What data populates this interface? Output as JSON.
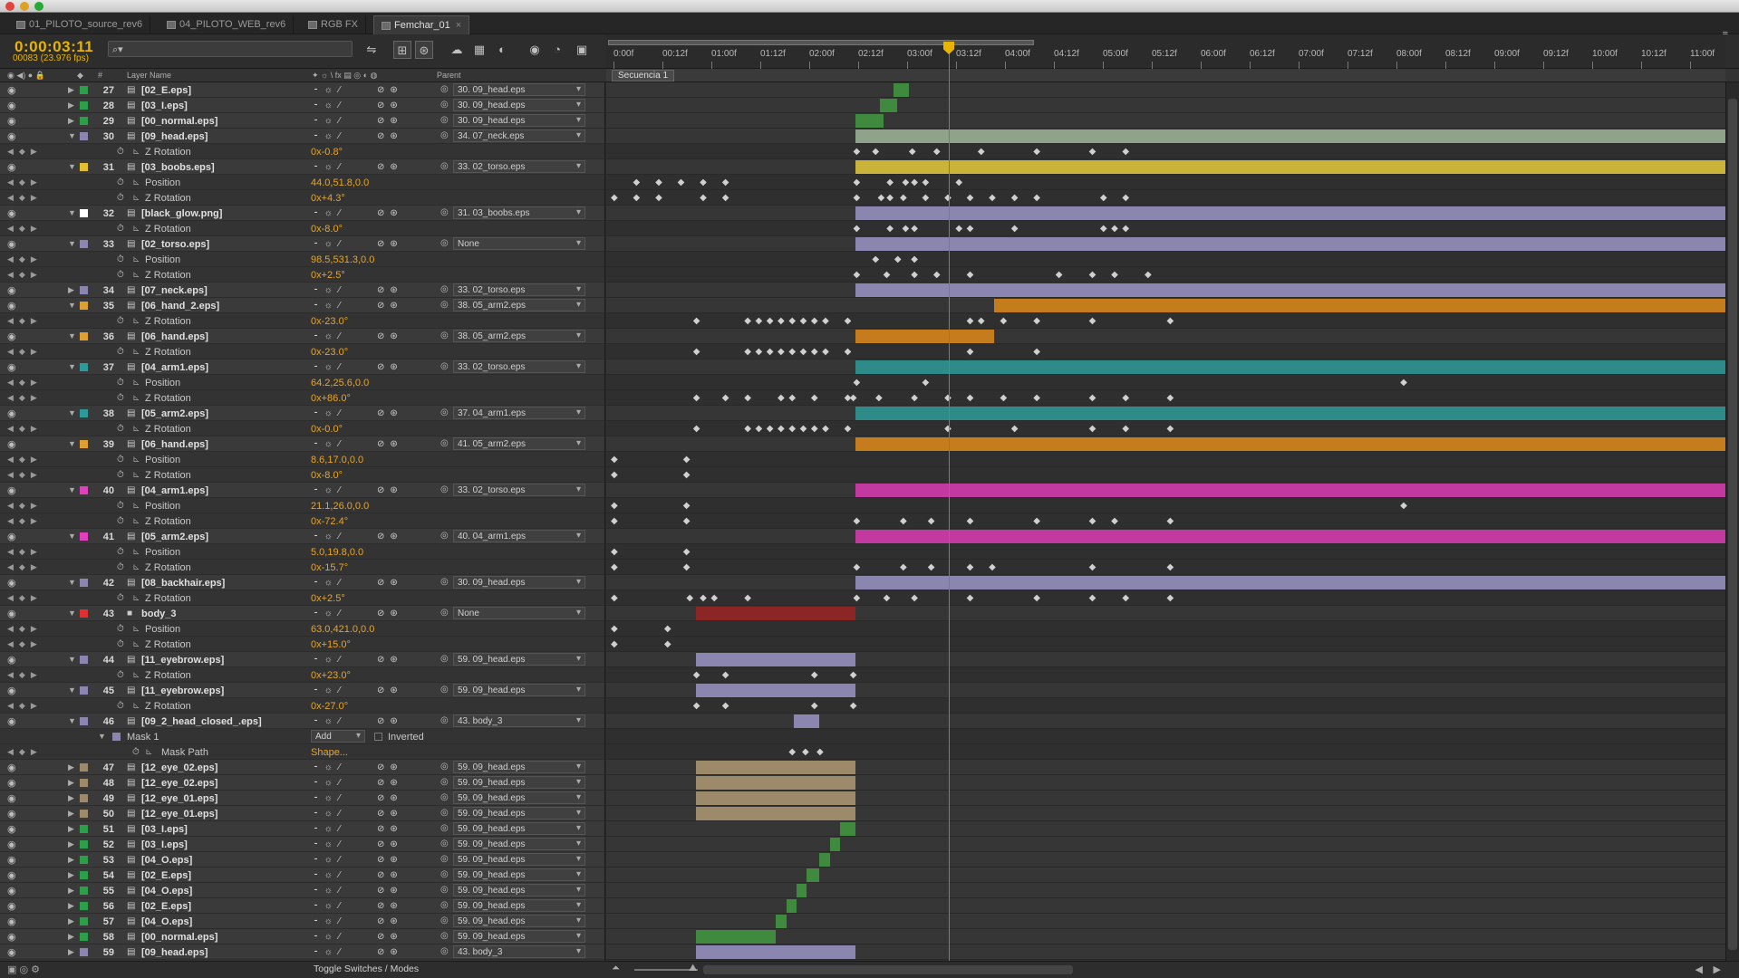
{
  "window": {
    "tabs": [
      {
        "label": "01_PILOTO_source_rev6"
      },
      {
        "label": "04_PILOTO_WEB_rev6"
      },
      {
        "label": "RGB FX"
      },
      {
        "label": "Femchar_01",
        "active": true
      }
    ]
  },
  "header": {
    "timecode": "0:00:03:11",
    "frames": "00083 (23.976 fps)",
    "search_placeholder": "⌕▾"
  },
  "columns": {
    "num": "#",
    "layer_name": "Layer Name",
    "parent": "Parent"
  },
  "composition": "Secuencia 1",
  "ruler": [
    "0:00f",
    "00:12f",
    "01:00f",
    "01:12f",
    "02:00f",
    "02:12f",
    "03:00f",
    "03:12f",
    "04:00f",
    "04:12f",
    "05:00f",
    "05:12f",
    "06:00f",
    "06:12f",
    "07:00f",
    "07:12f",
    "08:00f",
    "08:12f",
    "09:00f",
    "09:12f",
    "10:00f",
    "10:12f",
    "11:00f"
  ],
  "footer": {
    "toggle": "Toggle Switches / Modes"
  },
  "colors": {
    "green": "#3f8a3f",
    "lavender": "#8a86b0",
    "olive": "#c9b338",
    "orange": "#c47c1c",
    "teal": "#2f8a8a",
    "magenta": "#c23aa0",
    "red": "#8a2626",
    "tan": "#9c8a6a",
    "sage": "#8fa38a"
  },
  "rows": [
    {
      "k": "L",
      "n": "27",
      "name": "[02_E.eps]",
      "label": "#2e9e4a",
      "parent": "30. 09_head.eps",
      "bar": {
        "s": 0.252,
        "e": 0.266,
        "c": "green"
      }
    },
    {
      "k": "L",
      "n": "28",
      "name": "[03_I.eps]",
      "label": "#2e9e4a",
      "parent": "30. 09_head.eps",
      "bar": {
        "s": 0.24,
        "e": 0.255,
        "c": "green"
      }
    },
    {
      "k": "L",
      "n": "29",
      "name": "[00_normal.eps]",
      "label": "#2e9e4a",
      "parent": "30. 09_head.eps",
      "bar": {
        "s": 0.218,
        "e": 0.243,
        "c": "green"
      }
    },
    {
      "k": "L",
      "n": "30",
      "name": "[09_head.eps]",
      "label": "#8a86b0",
      "parent": "34. 07_neck.eps",
      "open": true,
      "bar": {
        "s": 0.218,
        "e": 1,
        "c": "sage"
      }
    },
    {
      "k": "P",
      "name": "Z Rotation",
      "val": "0x-0.8°",
      "keys": [
        0.218,
        0.235,
        0.268,
        0.29,
        0.33,
        0.38,
        0.43,
        0.46
      ]
    },
    {
      "k": "L",
      "n": "31",
      "name": "[03_boobs.eps]",
      "label": "#e0c030",
      "parent": "33. 02_torso.eps",
      "open": true,
      "bar": {
        "s": 0.218,
        "e": 1,
        "c": "olive"
      }
    },
    {
      "k": "P",
      "name": "Position",
      "val": "44.0,51.8,0.0",
      "keys": [
        0.02,
        0.04,
        0.06,
        0.08,
        0.1,
        0.218,
        0.248,
        0.262,
        0.27,
        0.28,
        0.31
      ]
    },
    {
      "k": "P",
      "name": "Z Rotation",
      "val": "0x+4.3°",
      "keys": [
        0.0,
        0.02,
        0.04,
        0.08,
        0.1,
        0.218,
        0.24,
        0.248,
        0.26,
        0.28,
        0.3,
        0.32,
        0.34,
        0.36,
        0.38,
        0.44,
        0.46
      ]
    },
    {
      "k": "L",
      "n": "32",
      "name": "[black_glow.png]",
      "label": "#ffffff",
      "parent": "31. 03_boobs.eps",
      "open": true,
      "bar": {
        "s": 0.218,
        "e": 1,
        "c": "lavender"
      }
    },
    {
      "k": "P",
      "name": "Z Rotation",
      "val": "0x-8.0°",
      "keys": [
        0.218,
        0.248,
        0.262,
        0.27,
        0.31,
        0.32,
        0.36,
        0.44,
        0.45,
        0.46
      ]
    },
    {
      "k": "L",
      "n": "33",
      "name": "[02_torso.eps]",
      "label": "#8a86b0",
      "parent": "None",
      "open": true,
      "bar": {
        "s": 0.218,
        "e": 1,
        "c": "lavender"
      }
    },
    {
      "k": "P",
      "name": "Position",
      "val": "98.5,531.3,0.0",
      "keys": [
        0.235,
        0.255,
        0.27
      ]
    },
    {
      "k": "P",
      "name": "Z Rotation",
      "val": "0x+2.5°",
      "keys": [
        0.218,
        0.245,
        0.27,
        0.29,
        0.32,
        0.4,
        0.43,
        0.45,
        0.48
      ]
    },
    {
      "k": "L",
      "n": "34",
      "name": "[07_neck.eps]",
      "label": "#8a86b0",
      "parent": "33. 02_torso.eps",
      "bar": {
        "s": 0.218,
        "e": 1,
        "c": "lavender"
      }
    },
    {
      "k": "L",
      "n": "35",
      "name": "[06_hand_2.eps]",
      "label": "#e0a030",
      "parent": "38. 05_arm2.eps",
      "open": true,
      "bar": {
        "s": 0.342,
        "e": 1,
        "c": "orange"
      }
    },
    {
      "k": "P",
      "name": "Z Rotation",
      "val": "0x-23.0°",
      "keys": [
        0.074,
        0.12,
        0.13,
        0.14,
        0.15,
        0.16,
        0.17,
        0.18,
        0.19,
        0.21,
        0.32,
        0.33,
        0.35,
        0.38,
        0.43,
        0.5
      ]
    },
    {
      "k": "L",
      "n": "36",
      "name": "[06_hand.eps]",
      "label": "#e0a030",
      "parent": "38. 05_arm2.eps",
      "open": true,
      "bar": {
        "s": 0.218,
        "e": 0.342,
        "c": "orange"
      }
    },
    {
      "k": "P",
      "name": "Z Rotation",
      "val": "0x-23.0°",
      "keys": [
        0.074,
        0.12,
        0.13,
        0.14,
        0.15,
        0.16,
        0.17,
        0.18,
        0.19,
        0.21,
        0.32,
        0.38
      ]
    },
    {
      "k": "L",
      "n": "37",
      "name": "[04_arm1.eps]",
      "label": "#2f9a9a",
      "parent": "33. 02_torso.eps",
      "open": true,
      "bar": {
        "s": 0.218,
        "e": 1,
        "c": "teal"
      }
    },
    {
      "k": "P",
      "name": "Position",
      "val": "64.2,25.6,0.0",
      "keys": [
        0.218,
        0.28,
        0.71
      ]
    },
    {
      "k": "P",
      "name": "Z Rotation",
      "val": "0x+86.0°",
      "keys": [
        0.074,
        0.1,
        0.12,
        0.15,
        0.16,
        0.18,
        0.21,
        0.215,
        0.238,
        0.27,
        0.3,
        0.32,
        0.35,
        0.38,
        0.43,
        0.46,
        0.5
      ]
    },
    {
      "k": "L",
      "n": "38",
      "name": "[05_arm2.eps]",
      "label": "#2f9a9a",
      "parent": "37. 04_arm1.eps",
      "open": true,
      "bar": {
        "s": 0.218,
        "e": 1,
        "c": "teal"
      }
    },
    {
      "k": "P",
      "name": "Z Rotation",
      "val": "0x-0.0°",
      "keys": [
        0.074,
        0.12,
        0.13,
        0.14,
        0.15,
        0.16,
        0.17,
        0.18,
        0.19,
        0.21,
        0.3,
        0.36,
        0.43,
        0.46,
        0.5
      ]
    },
    {
      "k": "L",
      "n": "39",
      "name": "[06_hand.eps]",
      "label": "#e0a030",
      "parent": "41. 05_arm2.eps",
      "open": true,
      "bar": {
        "s": 0.218,
        "e": 1,
        "c": "orange"
      }
    },
    {
      "k": "P",
      "name": "Position",
      "val": "8.6,17.0,0.0",
      "keys": [
        0.0,
        0.065
      ]
    },
    {
      "k": "P",
      "name": "Z Rotation",
      "val": "0x-8.0°",
      "keys": [
        0.0,
        0.065
      ]
    },
    {
      "k": "L",
      "n": "40",
      "name": "[04_arm1.eps]",
      "label": "#e040c0",
      "parent": "33. 02_torso.eps",
      "open": true,
      "bar": {
        "s": 0.218,
        "e": 1,
        "c": "magenta"
      }
    },
    {
      "k": "P",
      "name": "Position",
      "val": "21.1,26.0,0.0",
      "keys": [
        0.0,
        0.065,
        0.71
      ]
    },
    {
      "k": "P",
      "name": "Z Rotation",
      "val": "0x-72.4°",
      "keys": [
        0.0,
        0.065,
        0.218,
        0.26,
        0.285,
        0.32,
        0.38,
        0.43,
        0.45,
        0.5
      ]
    },
    {
      "k": "L",
      "n": "41",
      "name": "[05_arm2.eps]",
      "label": "#e040c0",
      "parent": "40. 04_arm1.eps",
      "open": true,
      "bar": {
        "s": 0.218,
        "e": 1,
        "c": "magenta"
      }
    },
    {
      "k": "P",
      "name": "Position",
      "val": "5.0,19.8,0.0",
      "keys": [
        0.0,
        0.065
      ]
    },
    {
      "k": "P",
      "name": "Z Rotation",
      "val": "0x-15.7°",
      "keys": [
        0.0,
        0.065,
        0.218,
        0.26,
        0.285,
        0.32,
        0.34,
        0.43,
        0.5
      ]
    },
    {
      "k": "L",
      "n": "42",
      "name": "[08_backhair.eps]",
      "label": "#8a86b0",
      "parent": "30. 09_head.eps",
      "open": true,
      "bar": {
        "s": 0.218,
        "e": 1,
        "c": "lavender"
      }
    },
    {
      "k": "P",
      "name": "Z Rotation",
      "val": "0x+2.5°",
      "keys": [
        0.0,
        0.068,
        0.08,
        0.09,
        0.12,
        0.218,
        0.245,
        0.27,
        0.32,
        0.38,
        0.43,
        0.46,
        0.5
      ]
    },
    {
      "k": "L",
      "n": "43",
      "name": "body_3",
      "label": "#e03030",
      "parent": "None",
      "open": true,
      "solid": true,
      "bar": {
        "s": 0.074,
        "e": 0.218,
        "c": "red"
      }
    },
    {
      "k": "P",
      "name": "Position",
      "val": "63.0,421.0,0.0",
      "keys": [
        0.0,
        0.048
      ]
    },
    {
      "k": "P",
      "name": "Z Rotation",
      "val": "0x+15.0°",
      "keys": [
        0.0,
        0.048
      ]
    },
    {
      "k": "L",
      "n": "44",
      "name": "[11_eyebrow.eps]",
      "label": "#8a86b0",
      "parent": "59. 09_head.eps",
      "open": true,
      "bar": {
        "s": 0.074,
        "e": 0.218,
        "c": "lavender"
      }
    },
    {
      "k": "P",
      "name": "Z Rotation",
      "val": "0x+23.0°",
      "keys": [
        0.074,
        0.1,
        0.18,
        0.215
      ]
    },
    {
      "k": "L",
      "n": "45",
      "name": "[11_eyebrow.eps]",
      "label": "#8a86b0",
      "parent": "59. 09_head.eps",
      "open": true,
      "bar": {
        "s": 0.074,
        "e": 0.218,
        "c": "lavender"
      }
    },
    {
      "k": "P",
      "name": "Z Rotation",
      "val": "0x-27.0°",
      "keys": [
        0.074,
        0.1,
        0.18,
        0.215
      ]
    },
    {
      "k": "L",
      "n": "46",
      "name": "[09_2_head_closed_.eps]",
      "label": "#8a86b0",
      "parent": "43. body_3",
      "open": true,
      "bar": {
        "s": 0.162,
        "e": 0.185,
        "c": "lavender"
      }
    },
    {
      "k": "M",
      "name": "Mask 1",
      "mode": "Add",
      "inverted": "Inverted"
    },
    {
      "k": "P",
      "name": "Mask Path",
      "val": "Shape...",
      "indent": true,
      "keys": [
        0.16,
        0.172,
        0.185
      ]
    },
    {
      "k": "L",
      "n": "47",
      "name": "[12_eye_02.eps]",
      "label": "#9c8a6a",
      "parent": "59. 09_head.eps",
      "bar": {
        "s": 0.074,
        "e": 0.218,
        "c": "tan"
      }
    },
    {
      "k": "L",
      "n": "48",
      "name": "[12_eye_02.eps]",
      "label": "#9c8a6a",
      "parent": "59. 09_head.eps",
      "bar": {
        "s": 0.074,
        "e": 0.218,
        "c": "tan"
      }
    },
    {
      "k": "L",
      "n": "49",
      "name": "[12_eye_01.eps]",
      "label": "#9c8a6a",
      "parent": "59. 09_head.eps",
      "bar": {
        "s": 0.074,
        "e": 0.218,
        "c": "tan"
      }
    },
    {
      "k": "L",
      "n": "50",
      "name": "[12_eye_01.eps]",
      "label": "#9c8a6a",
      "parent": "59. 09_head.eps",
      "bar": {
        "s": 0.074,
        "e": 0.218,
        "c": "tan"
      }
    },
    {
      "k": "L",
      "n": "51",
      "name": "[03_I.eps]",
      "label": "#2e9e4a",
      "parent": "59. 09_head.eps",
      "bar": {
        "s": 0.204,
        "e": 0.218,
        "c": "green"
      }
    },
    {
      "k": "L",
      "n": "52",
      "name": "[03_I.eps]",
      "label": "#2e9e4a",
      "parent": "59. 09_head.eps",
      "bar": {
        "s": 0.195,
        "e": 0.204,
        "c": "green"
      }
    },
    {
      "k": "L",
      "n": "53",
      "name": "[04_O.eps]",
      "label": "#2e9e4a",
      "parent": "59. 09_head.eps",
      "bar": {
        "s": 0.185,
        "e": 0.195,
        "c": "green"
      }
    },
    {
      "k": "L",
      "n": "54",
      "name": "[02_E.eps]",
      "label": "#2e9e4a",
      "parent": "59. 09_head.eps",
      "bar": {
        "s": 0.174,
        "e": 0.185,
        "c": "green"
      }
    },
    {
      "k": "L",
      "n": "55",
      "name": "[04_O.eps]",
      "label": "#2e9e4a",
      "parent": "59. 09_head.eps",
      "bar": {
        "s": 0.165,
        "e": 0.174,
        "c": "green"
      }
    },
    {
      "k": "L",
      "n": "56",
      "name": "[02_E.eps]",
      "label": "#2e9e4a",
      "parent": "59. 09_head.eps",
      "bar": {
        "s": 0.156,
        "e": 0.165,
        "c": "green"
      }
    },
    {
      "k": "L",
      "n": "57",
      "name": "[04_O.eps]",
      "label": "#2e9e4a",
      "parent": "59. 09_head.eps",
      "bar": {
        "s": 0.146,
        "e": 0.156,
        "c": "green"
      }
    },
    {
      "k": "L",
      "n": "58",
      "name": "[00_normal.eps]",
      "label": "#2e9e4a",
      "parent": "59. 09_head.eps",
      "bar": {
        "s": 0.074,
        "e": 0.146,
        "c": "green"
      }
    },
    {
      "k": "L",
      "n": "59",
      "name": "[09_head.eps]",
      "label": "#8a86b0",
      "parent": "43. body_3",
      "bar": {
        "s": 0.074,
        "e": 0.218,
        "c": "lavender"
      }
    }
  ]
}
